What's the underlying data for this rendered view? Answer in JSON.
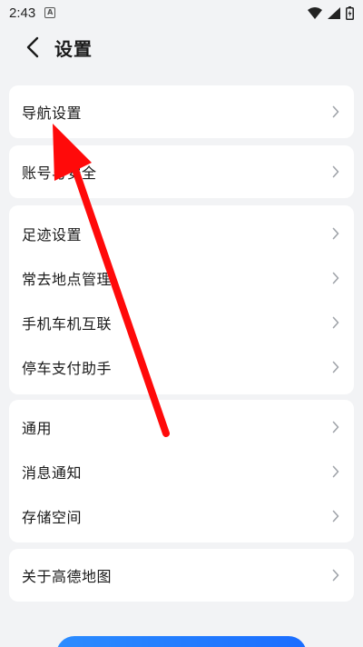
{
  "status_bar": {
    "time": "2:43",
    "app_icon": "A",
    "icons": [
      "wifi-icon",
      "signal-icon",
      "battery-charging-icon"
    ]
  },
  "header": {
    "back_icon": "chevron-left-icon",
    "title": "设置"
  },
  "groups": [
    {
      "items": [
        "导航设置"
      ]
    },
    {
      "items": [
        "账号与安全"
      ]
    },
    {
      "items": [
        "足迹设置",
        "常去地点管理",
        "手机车机互联",
        "停车支付助手"
      ]
    },
    {
      "items": [
        "通用",
        "消息通知",
        "存储空间"
      ]
    },
    {
      "items": [
        "关于高德地图"
      ]
    }
  ],
  "colors": {
    "background": "#f2f3f5",
    "card": "#ffffff",
    "annotation_arrow": "#ff0a0a",
    "primary_button": "#1a6dff"
  }
}
